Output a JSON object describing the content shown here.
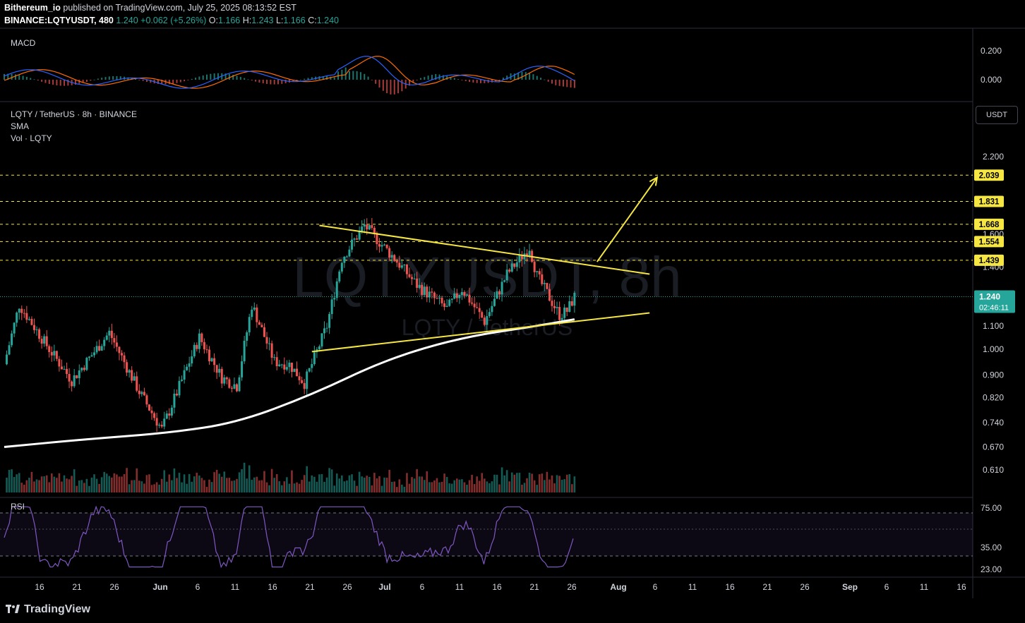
{
  "header": {
    "publisher": "Bithereum_io",
    "published_text": "published on TradingView.com, July 25, 2025 08:13:52 EST",
    "symbol_line": "BINANCE:LQTYUSDT, 480",
    "last": "1.240",
    "change": "+0.062 (+5.26%)",
    "o_label": "O:",
    "o": "1.166",
    "h_label": "H:",
    "h": "1.243",
    "l_label": "L:",
    "l": "1.166",
    "c_label": "C:",
    "c": "1.240"
  },
  "panes": {
    "macd_label": "MACD",
    "main_title": "LQTY / TetherUS · 8h · BINANCE",
    "sma_label": "SMA",
    "vol_label": "Vol · LQTY",
    "rsi_label": "RSI",
    "watermark_main": "LQTYUSDT, 8h",
    "watermark_sub": "LQTY / TetherUS"
  },
  "currency_button": "USDT",
  "footer_logo": "TradingView",
  "colors": {
    "up": "#26a69a",
    "down": "#ef5350",
    "sma": "#ffffff",
    "trend": "#f5e642",
    "level": "#f5e642",
    "macd": "#2962ff",
    "signal": "#ff6d00",
    "rsi": "#7e57c2"
  },
  "chart_data": {
    "type": "candlestick",
    "timeframe": "8h",
    "price_axis": {
      "scale": "log",
      "ticks": [
        "2.200",
        "1.600",
        "1.400",
        "1.100",
        "1.000",
        "0.900",
        "0.820",
        "0.740",
        "0.670",
        "0.610"
      ]
    },
    "x_ticks": [
      "16",
      "21",
      "26",
      "Jun",
      "6",
      "11",
      "16",
      "21",
      "26",
      "Jul",
      "6",
      "11",
      "16",
      "21",
      "26",
      "Aug",
      "6",
      "11",
      "16",
      "21",
      "26",
      "Sep",
      "6",
      "11",
      "16"
    ],
    "levels": [
      "2.039",
      "1.831",
      "1.668",
      "1.554",
      "1.439"
    ],
    "current_price": "1.240",
    "countdown": "02:46:11",
    "trendlines": [
      {
        "name": "resistance",
        "from": [
          "2025-06-21",
          1.66
        ],
        "to": [
          "2025-08-04",
          1.36
        ]
      },
      {
        "name": "support",
        "from": [
          "2025-06-20",
          0.99
        ],
        "to": [
          "2025-08-04",
          1.16
        ]
      }
    ],
    "projection_arrow": {
      "from": [
        "2025-07-28",
        1.43
      ],
      "to": [
        "2025-08-05",
        2.02
      ]
    },
    "sma_path": [
      [
        "2025-05-10",
        0.67
      ],
      [
        "2025-05-20",
        0.69
      ],
      [
        "2025-06-01",
        0.71
      ],
      [
        "2025-06-10",
        0.74
      ],
      [
        "2025-06-20",
        0.83
      ],
      [
        "2025-06-30",
        0.96
      ],
      [
        "2025-07-10",
        1.05
      ],
      [
        "2025-07-20",
        1.1
      ],
      [
        "2025-07-25",
        1.13
      ]
    ],
    "price_path": [
      [
        "2025-05-10",
        0.94
      ],
      [
        "2025-05-12",
        1.2
      ],
      [
        "2025-05-16",
        1.0
      ],
      [
        "2025-05-19",
        0.88
      ],
      [
        "2025-05-24",
        1.07
      ],
      [
        "2025-05-28",
        0.84
      ],
      [
        "2025-05-31",
        0.72
      ],
      [
        "2025-06-05",
        1.05
      ],
      [
        "2025-06-08",
        0.89
      ],
      [
        "2025-06-10",
        0.86
      ],
      [
        "2025-06-12",
        1.2
      ],
      [
        "2025-06-15",
        0.95
      ],
      [
        "2025-06-17",
        0.94
      ],
      [
        "2025-06-19",
        0.87
      ],
      [
        "2025-06-22",
        1.1
      ],
      [
        "2025-06-24",
        1.45
      ],
      [
        "2025-06-27",
        1.66
      ],
      [
        "2025-07-01",
        1.45
      ],
      [
        "2025-07-04",
        1.3
      ],
      [
        "2025-07-08",
        1.18
      ],
      [
        "2025-07-10",
        1.28
      ],
      [
        "2025-07-13",
        1.12
      ],
      [
        "2025-07-16",
        1.36
      ],
      [
        "2025-07-19",
        1.52
      ],
      [
        "2025-07-20",
        1.35
      ],
      [
        "2025-07-23",
        1.15
      ],
      [
        "2025-07-24",
        1.17
      ],
      [
        "2025-07-25",
        1.24
      ]
    ],
    "macd_axis": [
      "0.200",
      "0.000"
    ],
    "rsi_axis": [
      "75.00",
      "35.00",
      "23.00"
    ]
  }
}
